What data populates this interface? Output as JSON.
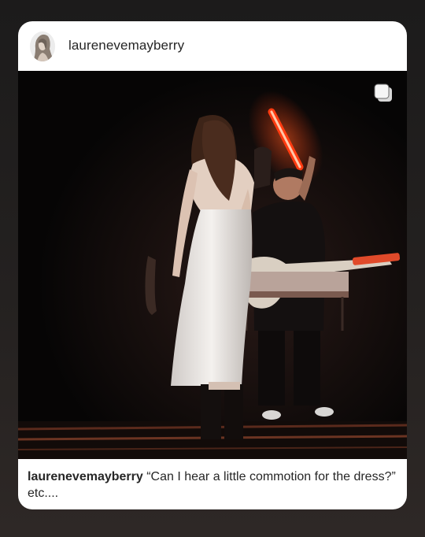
{
  "post": {
    "username": "laurenevemayberry",
    "caption_username": "laurenevemayberry",
    "caption_text": "“Can I hear a little commotion for the dress?” etc....",
    "avatar_icon": "profile-photo",
    "multi_image_icon": "multiple-photos-icon"
  },
  "colors": {
    "background": "#1f1d1c",
    "card": "#ffffff",
    "text": "#262626",
    "light_saber": "#ff3b10"
  }
}
